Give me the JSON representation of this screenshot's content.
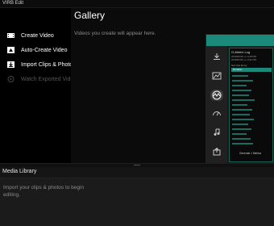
{
  "window": {
    "title": "VIRB Edit"
  },
  "sidebar": {
    "items": [
      {
        "label": "Create Video",
        "icon": "film-icon",
        "enabled": true
      },
      {
        "label": "Auto-Create Video",
        "icon": "auto-create-icon",
        "enabled": true
      },
      {
        "label": "Import Clips & Photos",
        "icon": "import-icon",
        "enabled": true
      },
      {
        "label": "Watch Exported Video",
        "icon": "play-icon",
        "enabled": false
      }
    ]
  },
  "gallery": {
    "title": "Gallery",
    "empty_text": "Videos you create will appear here.",
    "preview": {
      "accent": "#1c8a7a",
      "panel_lines": [
        "G-Metrix Log",
        "2016/02/16 ••• 4:28 PM",
        "2016/02/16 ••• 4:31 PM",
        "Sort this list by",
        "Duration"
      ],
      "panel_button": "Generate 1 Metrics",
      "icons": [
        "download-icon",
        "chart-icon",
        "metrics-icon",
        "gauge-icon",
        "music-icon",
        "share-icon"
      ]
    }
  },
  "media_library": {
    "title": "Media Library",
    "hint": "Import your clips & photos to begin editing."
  }
}
